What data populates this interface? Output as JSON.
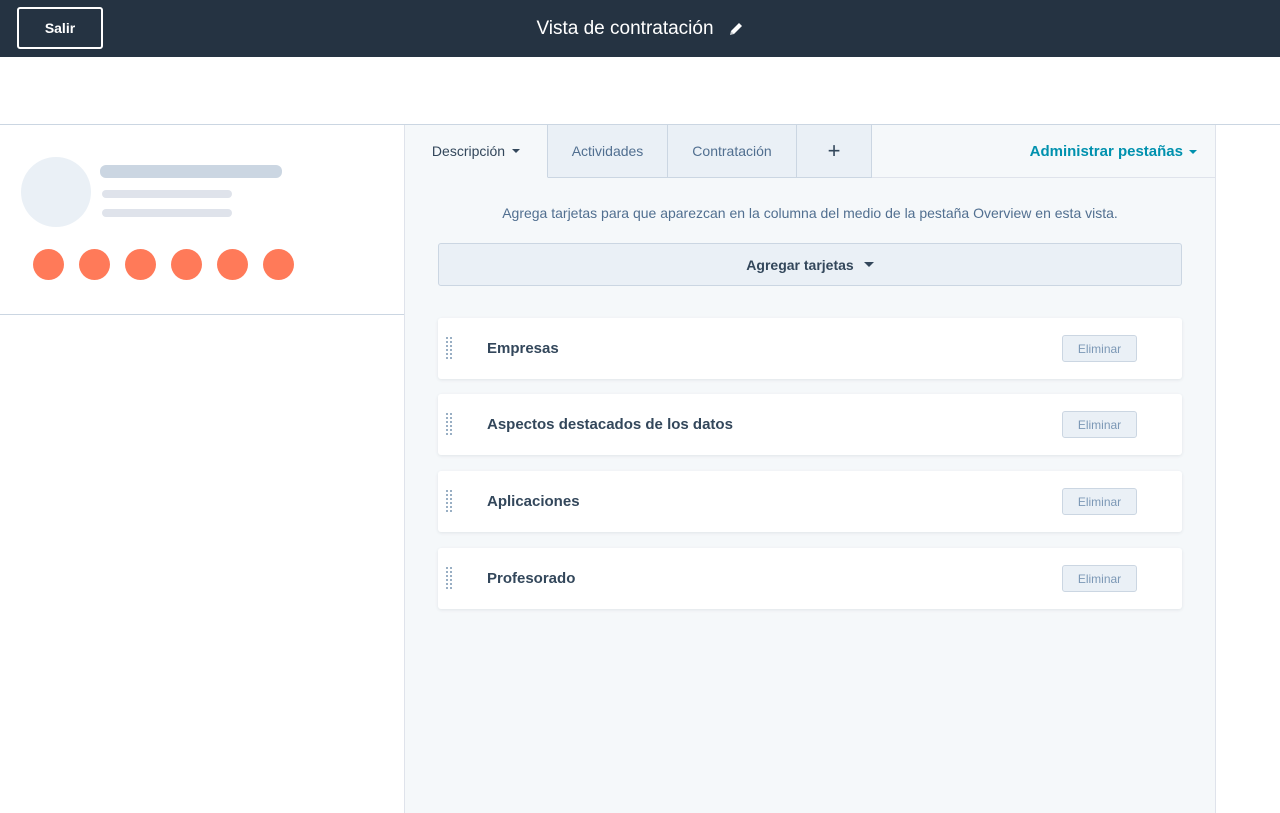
{
  "topbar": {
    "exit_label": "Salir",
    "title": "Vista de contratación",
    "edit_icon": "pencil-icon",
    "bg_color": "#253342"
  },
  "sidebar": {
    "action_count": 6,
    "action_color": "#ff7a59"
  },
  "tabs": [
    {
      "label": "Descripción",
      "active": true,
      "has_dropdown": true
    },
    {
      "label": "Actividades",
      "active": false
    },
    {
      "label": "Contratación",
      "active": false
    }
  ],
  "add_tab_label": "+",
  "manage_tabs_label": "Administrar pestañas",
  "hint_text": "Agrega tarjetas para que aparezcan en la columna del medio de la pestaña Overview en esta vista.",
  "add_cards_label": "Agregar tarjetas",
  "cards": [
    {
      "title": "Empresas",
      "remove_label": "Eliminar"
    },
    {
      "title": "Aspectos destacados de los datos",
      "remove_label": "Eliminar"
    },
    {
      "title": "Aplicaciones",
      "remove_label": "Eliminar"
    },
    {
      "title": "Profesorado",
      "remove_label": "Eliminar"
    }
  ],
  "colors": {
    "accent_link": "#0091ae",
    "text": "#33475b",
    "panel_bg": "#f5f8fa"
  }
}
